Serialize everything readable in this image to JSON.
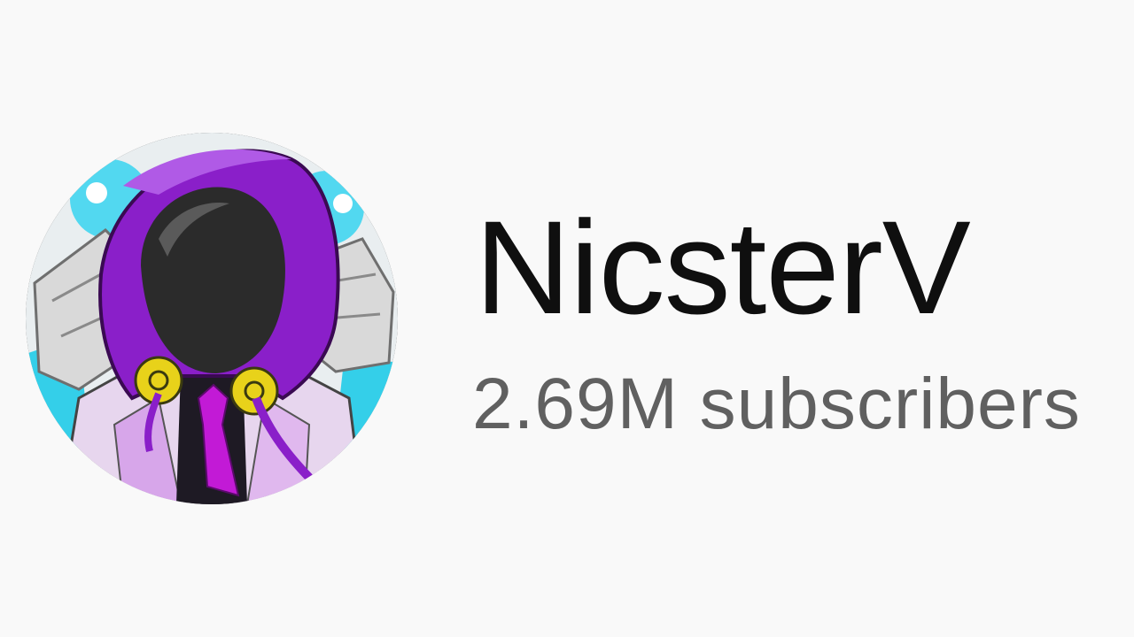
{
  "channel": {
    "name": "NicsterV",
    "subscribers": "2.69M subscribers",
    "avatar_icon": "hooded-character-avatar"
  },
  "colors": {
    "background": "#f9f9f9",
    "name_text": "#0f0f0f",
    "subscriber_text": "#606060",
    "hood_purple": "#8a1fc9",
    "accent_cyan": "#3fd3ef",
    "button_yellow": "#e8d21a"
  }
}
